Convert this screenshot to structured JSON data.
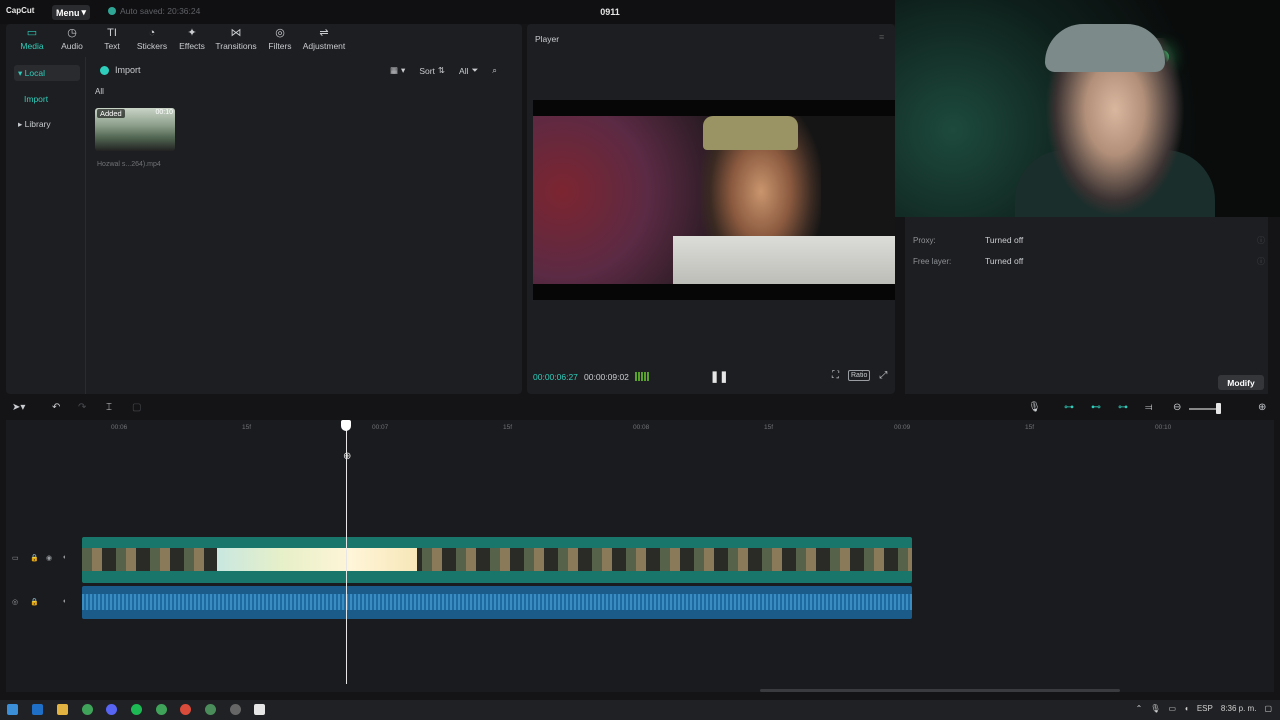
{
  "app": {
    "logo": "CapCut",
    "menu_label": "Menu",
    "autosave_text": "Auto saved: 20:36:24",
    "project_title": "0911"
  },
  "toolbar": [
    {
      "label": "Media",
      "icon": "media-icon",
      "glyph": "▭",
      "active": true
    },
    {
      "label": "Audio",
      "icon": "audio-icon",
      "glyph": "◷"
    },
    {
      "label": "Text",
      "icon": "text-icon",
      "glyph": "TI"
    },
    {
      "label": "Stickers",
      "icon": "stickers-icon",
      "glyph": "◔"
    },
    {
      "label": "Effects",
      "icon": "effects-icon",
      "glyph": "✦"
    },
    {
      "label": "Transitions",
      "icon": "transitions-icon",
      "glyph": "⋈"
    },
    {
      "label": "Filters",
      "icon": "filters-icon",
      "glyph": "◎"
    },
    {
      "label": "Adjustment",
      "icon": "adjustment-icon",
      "glyph": "⇌"
    }
  ],
  "sidebar": {
    "local": "Local",
    "import": "Import",
    "library": "Library"
  },
  "media": {
    "import_label": "Import",
    "sort_label": "Sort",
    "filter_label": "All",
    "all_label": "All",
    "clip": {
      "badge": "Added",
      "duration": "00:10",
      "name": "Hozwal s...264).mp4"
    }
  },
  "player": {
    "title": "Player",
    "current_time": "00:00:06:27",
    "total_time": "00:00:09:02",
    "ratio_label": "Ratio"
  },
  "properties": {
    "rows": [
      {
        "label": "Proxy:",
        "value": "Turned off"
      },
      {
        "label": "Free layer:",
        "value": "Turned off"
      }
    ],
    "modify_label": "Modify"
  },
  "timeline": {
    "ticks": [
      "00:06",
      "15f",
      "00:07",
      "15f",
      "00:08",
      "15f",
      "00:09",
      "15f",
      "00:10"
    ]
  },
  "taskbar": {
    "language": "ESP",
    "time": "8:36 p. m."
  },
  "colors": {
    "accent": "#2fcdbb",
    "video_track": "#19766a",
    "audio_track": "#1a5b8a"
  }
}
